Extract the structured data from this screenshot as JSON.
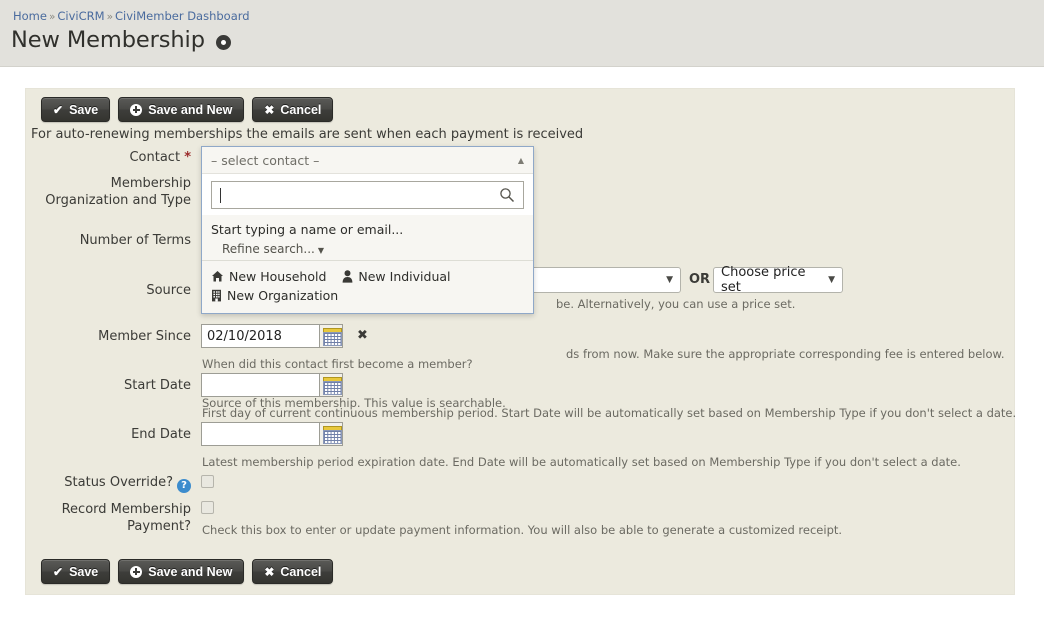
{
  "breadcrumb": {
    "items": [
      {
        "label": "Home"
      },
      {
        "label": "CiviCRM"
      },
      {
        "label": "CiviMember Dashboard"
      }
    ],
    "separator": "»"
  },
  "header": {
    "title": "New Membership",
    "gear_icon": "gear-icon"
  },
  "toolbar": {
    "save_label": "Save",
    "save_and_new_label": "Save and New",
    "cancel_label": "Cancel",
    "save_icon": "check-icon",
    "save_and_new_icon": "plus-circle-icon",
    "cancel_icon": "x-icon"
  },
  "form": {
    "intro": "For auto-renewing memberships the emails are sent when each payment is received",
    "rows": {
      "contact": {
        "label": "Contact",
        "required_marker": "*"
      },
      "membership": {
        "label_line1": "Membership",
        "label_line2": "Organization and Type",
        "type_select_value": "",
        "or_text": "OR",
        "price_set_value": "Choose price set",
        "help": "be. Alternatively, you can use a price set."
      },
      "terms": {
        "label": "Number of Terms",
        "help": "ds from now. Make sure the appropriate corresponding fee is entered below."
      },
      "source": {
        "label": "Source",
        "help": "Source of this membership. This value is searchable."
      },
      "member_since": {
        "label": "Member Since",
        "value": "02/10/2018",
        "clear_label": "✖",
        "help": "When did this contact first become a member?"
      },
      "start_date": {
        "label": "Start Date",
        "value": "",
        "help": "First day of current continuous membership period. Start Date will be automatically set based on Membership Type if you don't select a date."
      },
      "end_date": {
        "label": "End Date",
        "value": "",
        "help": "Latest membership period expiration date. End Date will be automatically set based on Membership Type if you don't select a date."
      },
      "status_override": {
        "label": "Status Override?",
        "help_icon": "help-question-icon",
        "checked": false
      },
      "record_payment": {
        "label_line1": "Record Membership",
        "label_line2": "Payment?",
        "checked": false,
        "help": "Check this box to enter or update payment information. You will also be able to generate a customized receipt."
      }
    }
  },
  "contact_dropdown": {
    "header_label": "– select contact –",
    "collapse_icon": "caret-up-icon",
    "search_value": "",
    "search_icon": "search-icon",
    "hint": "Start typing a name or email...",
    "refine_label": "Refine search...",
    "refine_caret": "▼",
    "actions": [
      {
        "label": "New Household",
        "icon": "house-icon"
      },
      {
        "label": "New Individual",
        "icon": "person-icon"
      },
      {
        "label": "New Organization",
        "icon": "building-icon"
      }
    ]
  },
  "colors": {
    "header_band": "#e2e1dc",
    "panel_bg": "#eceade",
    "link": "#4a6b9e",
    "required": "#9b2b2b",
    "button": "#434340",
    "help_icon": "#3c8ccd",
    "dropdown_border": "#8fa8c8"
  }
}
